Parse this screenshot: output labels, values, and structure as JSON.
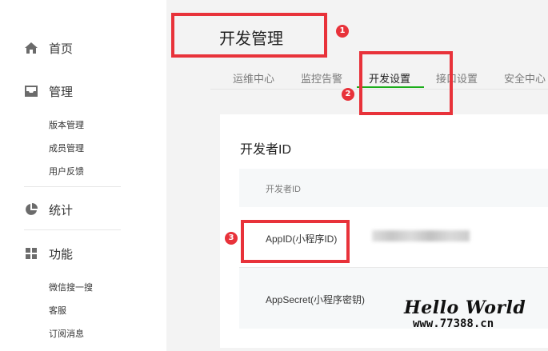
{
  "sidebar": {
    "home": {
      "label": "首页",
      "icon": "home-icon"
    },
    "manage": {
      "label": "管理",
      "icon": "inbox-icon",
      "items": [
        "版本管理",
        "成员管理",
        "用户反馈"
      ]
    },
    "stats": {
      "label": "统计",
      "icon": "pie-chart-icon"
    },
    "features": {
      "label": "功能",
      "icon": "grid-icon",
      "items": [
        "微信搜一搜",
        "客服",
        "订阅消息"
      ]
    }
  },
  "header": {
    "title": "开发管理",
    "tabs": [
      {
        "label": "运维中心"
      },
      {
        "label": "监控告警"
      },
      {
        "label": "开发设置",
        "active": true
      },
      {
        "label": "接口设置"
      },
      {
        "label": "安全中心"
      }
    ]
  },
  "card": {
    "title": "开发者ID",
    "table_header": "开发者ID",
    "rows": [
      {
        "label": "AppID(小程序ID)"
      },
      {
        "label": "AppSecret(小程序密钥)"
      }
    ]
  },
  "annotations": [
    "1",
    "2",
    "3"
  ],
  "watermark": {
    "line1": "Hello World",
    "line2": "www.77388.cn"
  },
  "colors": {
    "accent": "#1aad19",
    "highlight": "#e8323a"
  }
}
